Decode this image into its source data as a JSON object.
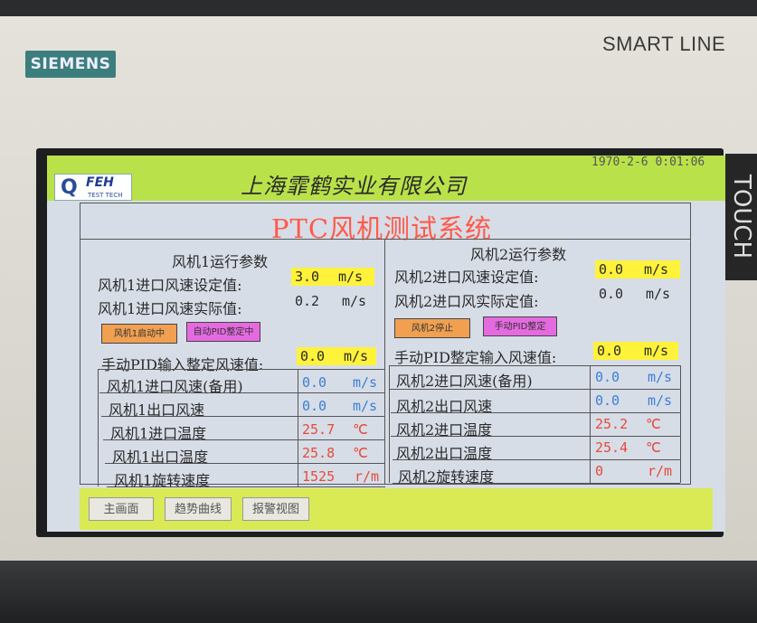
{
  "device": {
    "brand": "SIEMENS",
    "model": "SMART LINE",
    "side_label": "TOUCH"
  },
  "header": {
    "logo_mark": "Q",
    "logo_word": "FEH",
    "logo_sub": "TEST TECH",
    "company": "上海霏鹤实业有限公司",
    "datetime": "1970-2-6 0:01:06",
    "title": "PTC风机测试系统",
    "bar_color": "#b9e24a"
  },
  "fan1": {
    "section_title": "风机1运行参数",
    "setpoint_label": "风机1进口风速设定值:",
    "setpoint_value": "3.0",
    "setpoint_unit": "m/s",
    "actual_label": "风机1进口风速实际值:",
    "actual_value": "0.2",
    "actual_unit": "m/s",
    "start_button": "风机1启动中",
    "pid_button": "自动PID整定中",
    "manual_pid_label": "手动PID输入整定风速值:",
    "manual_pid_value": "0.0",
    "manual_pid_unit": "m/s",
    "rows": [
      {
        "label": "风机1进口风速(备用)",
        "value": "0.0",
        "unit": "m/s"
      },
      {
        "label": "风机1出口风速",
        "value": "0.0",
        "unit": "m/s"
      },
      {
        "label": "风机1进口温度",
        "value": "25.7",
        "unit": "℃"
      },
      {
        "label": "风机1出口温度",
        "value": "25.8",
        "unit": "℃"
      },
      {
        "label": "风机1旋转速度",
        "value": "1525",
        "unit": "r/m"
      }
    ]
  },
  "fan2": {
    "section_title": "风机2运行参数",
    "setpoint_label": "风机2进口风速设定值:",
    "setpoint_value": "0.0",
    "setpoint_unit": "m/s",
    "actual_label": "风机2进口风实际定值:",
    "actual_value": "0.0",
    "actual_unit": "m/s",
    "stop_button": "风机2停止",
    "pid_button": "手动PID整定",
    "manual_pid_label": "手动PID整定输入风速值:",
    "manual_pid_value": "0.0",
    "manual_pid_unit": "m/s",
    "rows": [
      {
        "label": "风机2进口风速(备用)",
        "value": "0.0",
        "unit": "m/s"
      },
      {
        "label": "风机2出口风速",
        "value": "0.0",
        "unit": "m/s"
      },
      {
        "label": "风机2进口温度",
        "value": "25.2",
        "unit": "℃"
      },
      {
        "label": "风机2出口温度",
        "value": "25.4",
        "unit": "℃"
      },
      {
        "label": "风机2旋转速度",
        "value": "0",
        "unit": "r/m"
      }
    ]
  },
  "footer": {
    "buttons": [
      "主画面",
      "趋势曲线",
      "报警视图"
    ]
  },
  "colors": {
    "highlight": "#fff23a",
    "title_red": "#ff5a4a",
    "value_blue": "#3a7fd6",
    "value_red": "#e64a3a"
  }
}
